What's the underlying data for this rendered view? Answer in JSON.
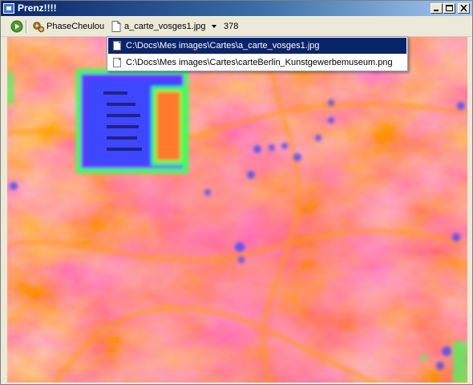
{
  "window": {
    "title": "Prenz!!!!"
  },
  "toolbar": {
    "play_icon": "play-icon",
    "phase_label": "PhaseCheulou",
    "phase_icon": "gears-icon",
    "file_icon": "file-icon",
    "current_file": "a_carte_vosges1.jpg",
    "dropdown_icon": "chevron-down-icon",
    "count": "378"
  },
  "dropdown": {
    "items": [
      {
        "label": "C:\\Docs\\Mes images\\Cartes\\a_carte_vosges1.jpg",
        "selected": true
      },
      {
        "label": "C:\\Docs\\Mes images\\Cartes\\carteBerlin_Kunstgewerbemuseum.png",
        "selected": false
      }
    ]
  },
  "colors": {
    "highlight": "#0a246a",
    "map_base": "#ff5a1e",
    "map_warm": "#ff8a1a",
    "map_pink": "#ff3c8c",
    "map_blue": "#3c46ff",
    "map_green": "#3cff5a"
  }
}
